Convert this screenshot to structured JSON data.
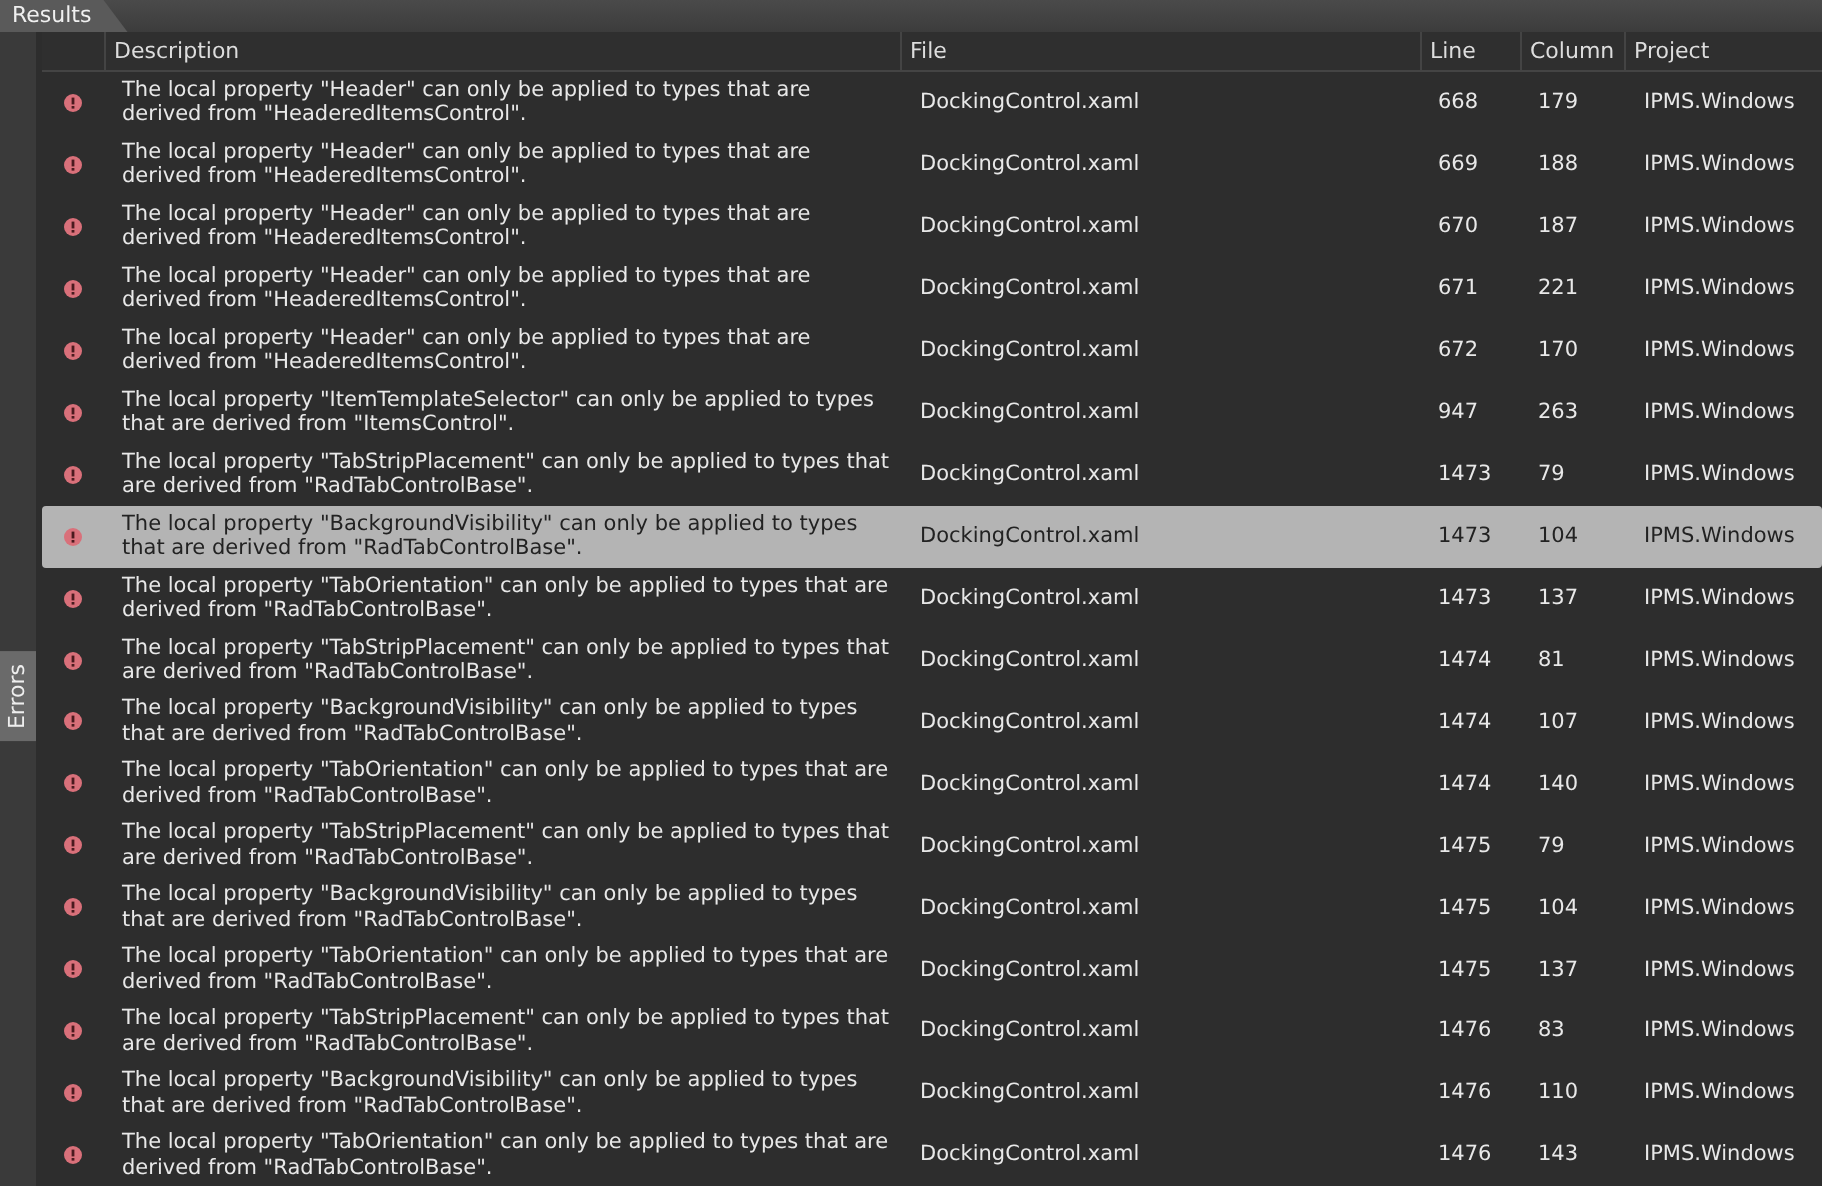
{
  "tabs": [
    {
      "label": "Results",
      "selected": true
    }
  ],
  "side_tabs": [
    {
      "label": "Errors",
      "selected": true
    }
  ],
  "table": {
    "columns": [
      "Description",
      "File",
      "Line",
      "Column",
      "Project"
    ],
    "rows": [
      {
        "description": "The local property \"Header\" can only be applied to types that are derived from \"HeaderedItemsControl\".",
        "file": "DockingControl.xaml",
        "line": "668",
        "column": "179",
        "project": "IPMS.Windows",
        "selected": false
      },
      {
        "description": "The local property \"Header\" can only be applied to types that are derived from \"HeaderedItemsControl\".",
        "file": "DockingControl.xaml",
        "line": "669",
        "column": "188",
        "project": "IPMS.Windows",
        "selected": false
      },
      {
        "description": "The local property \"Header\" can only be applied to types that are derived from \"HeaderedItemsControl\".",
        "file": "DockingControl.xaml",
        "line": "670",
        "column": "187",
        "project": "IPMS.Windows",
        "selected": false
      },
      {
        "description": "The local property \"Header\" can only be applied to types that are derived from \"HeaderedItemsControl\".",
        "file": "DockingControl.xaml",
        "line": "671",
        "column": "221",
        "project": "IPMS.Windows",
        "selected": false
      },
      {
        "description": "The local property \"Header\" can only be applied to types that are derived from \"HeaderedItemsControl\".",
        "file": "DockingControl.xaml",
        "line": "672",
        "column": "170",
        "project": "IPMS.Windows",
        "selected": false
      },
      {
        "description": "The local property \"ItemTemplateSelector\" can only be applied to types that are derived from \"ItemsControl\".",
        "file": "DockingControl.xaml",
        "line": "947",
        "column": "263",
        "project": "IPMS.Windows",
        "selected": false
      },
      {
        "description": "The local property \"TabStripPlacement\" can only be applied to types that are derived from \"RadTabControlBase\".",
        "file": "DockingControl.xaml",
        "line": "1473",
        "column": "79",
        "project": "IPMS.Windows",
        "selected": false
      },
      {
        "description": "The local property \"BackgroundVisibility\" can only be applied to types that are derived from \"RadTabControlBase\".",
        "file": "DockingControl.xaml",
        "line": "1473",
        "column": "104",
        "project": "IPMS.Windows",
        "selected": true
      },
      {
        "description": "The local property \"TabOrientation\" can only be applied to types that are derived from \"RadTabControlBase\".",
        "file": "DockingControl.xaml",
        "line": "1473",
        "column": "137",
        "project": "IPMS.Windows",
        "selected": false
      },
      {
        "description": "The local property \"TabStripPlacement\" can only be applied to types that are derived from \"RadTabControlBase\".",
        "file": "DockingControl.xaml",
        "line": "1474",
        "column": "81",
        "project": "IPMS.Windows",
        "selected": false
      },
      {
        "description": "The local property \"BackgroundVisibility\" can only be applied to types that are derived from \"RadTabControlBase\".",
        "file": "DockingControl.xaml",
        "line": "1474",
        "column": "107",
        "project": "IPMS.Windows",
        "selected": false
      },
      {
        "description": "The local property \"TabOrientation\" can only be applied to types that are derived from \"RadTabControlBase\".",
        "file": "DockingControl.xaml",
        "line": "1474",
        "column": "140",
        "project": "IPMS.Windows",
        "selected": false
      },
      {
        "description": "The local property \"TabStripPlacement\" can only be applied to types that are derived from \"RadTabControlBase\".",
        "file": "DockingControl.xaml",
        "line": "1475",
        "column": "79",
        "project": "IPMS.Windows",
        "selected": false
      },
      {
        "description": "The local property \"BackgroundVisibility\" can only be applied to types that are derived from \"RadTabControlBase\".",
        "file": "DockingControl.xaml",
        "line": "1475",
        "column": "104",
        "project": "IPMS.Windows",
        "selected": false
      },
      {
        "description": "The local property \"TabOrientation\" can only be applied to types that are derived from \"RadTabControlBase\".",
        "file": "DockingControl.xaml",
        "line": "1475",
        "column": "137",
        "project": "IPMS.Windows",
        "selected": false
      },
      {
        "description": "The local property \"TabStripPlacement\" can only be applied to types that are derived from \"RadTabControlBase\".",
        "file": "DockingControl.xaml",
        "line": "1476",
        "column": "83",
        "project": "IPMS.Windows",
        "selected": false
      },
      {
        "description": "The local property \"BackgroundVisibility\" can only be applied to types that are derived from \"RadTabControlBase\".",
        "file": "DockingControl.xaml",
        "line": "1476",
        "column": "110",
        "project": "IPMS.Windows",
        "selected": false
      },
      {
        "description": "The local property \"TabOrientation\" can only be applied to types that are derived from \"RadTabControlBase\".",
        "file": "DockingControl.xaml",
        "line": "1476",
        "column": "143",
        "project": "IPMS.Windows",
        "selected": false
      }
    ]
  }
}
